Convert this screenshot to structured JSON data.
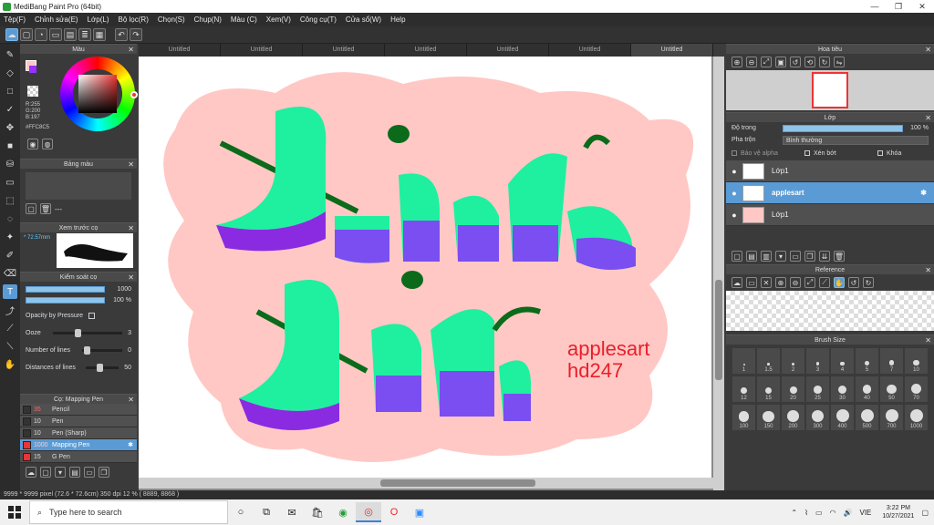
{
  "window": {
    "title": "MediBang Paint Pro (64bit)",
    "minimize": "—",
    "maximize": "❐",
    "close": "✕"
  },
  "menu": [
    "Tệp(F)",
    "Chỉnh sửa(E)",
    "Lớp(L)",
    "Bộ lọc(R)",
    "Chọn(S)",
    "Chụp(N)",
    "Màu (C)",
    "Xem(V)",
    "Công cụ(T)",
    "Cửa sổ(W)",
    "Help"
  ],
  "tabs": [
    "Untitled",
    "Untitled",
    "Untitled",
    "Untitled",
    "Untitled",
    "Untitled",
    "Untitled"
  ],
  "left_panel": {
    "color_title": "Màu",
    "rgb": {
      "r": "R:255",
      "g": "G:200",
      "b": "B:197",
      "hex": "#FFC8C5"
    },
    "palette_title": "Bảng màu",
    "palette_dash": "---",
    "preview_title": "Xem trước cọ",
    "preview_size": "* 72.57mm",
    "brush_control_title": "Kiểm soát cọ",
    "size_value": "1000",
    "opacity_value": "100 %",
    "opacity_by_pressure": "Opacity by Pressure",
    "ooze_label": "Ooze",
    "ooze_value": "3",
    "lines_label": "Number of lines",
    "lines_value": "0",
    "distance_label": "Distances of lines",
    "distance_value": "50",
    "brush_list_title": "Cọ: Mapping Pen",
    "brushes": [
      {
        "size": "35",
        "name": "Pencil"
      },
      {
        "size": "10",
        "name": "Pen"
      },
      {
        "size": "10",
        "name": "Pen (Sharp)"
      },
      {
        "size": "1000",
        "name": "Mapping Pen"
      },
      {
        "size": "15",
        "name": "G Pen"
      }
    ]
  },
  "canvas_text": {
    "line1": "applesart",
    "line2": "hd247"
  },
  "right_panel": {
    "navigator_title": "Hoa tiêu",
    "layer_title": "Lớp",
    "opacity_label": "Độ trong",
    "opacity_value": "100 %",
    "blend_label": "Pha trộn",
    "blend_value": "Bình thường",
    "protect_alpha": "Bảo vệ alpha",
    "clipping": "Xén bớt",
    "lock": "Khóa",
    "layers": [
      "Lớp1",
      "applesart",
      "Lớp1"
    ],
    "reference_title": "Reference",
    "brush_size_title": "Brush Size",
    "brush_sizes": [
      "1",
      "1.5",
      "2",
      "3",
      "4",
      "5",
      "7",
      "10",
      "12",
      "15",
      "20",
      "25",
      "30",
      "40",
      "50",
      "70",
      "100",
      "150",
      "200",
      "300",
      "400",
      "500",
      "700",
      "1000"
    ]
  },
  "status": "9999 * 9999 pixel   (72.6 * 72.6cm)   350 dpi   12 %   ( 8889, 8868 )",
  "taskbar": {
    "search_placeholder": "Type here to search",
    "lang": "VIE",
    "time": "3:22 PM",
    "date": "10/27/2021"
  },
  "colors": {
    "accent": "#5b9bd5",
    "mint": "#1ef0a0",
    "purple": "#8a2be2",
    "pink_bg": "#ffc8c5",
    "watermark": "#e8202a"
  }
}
